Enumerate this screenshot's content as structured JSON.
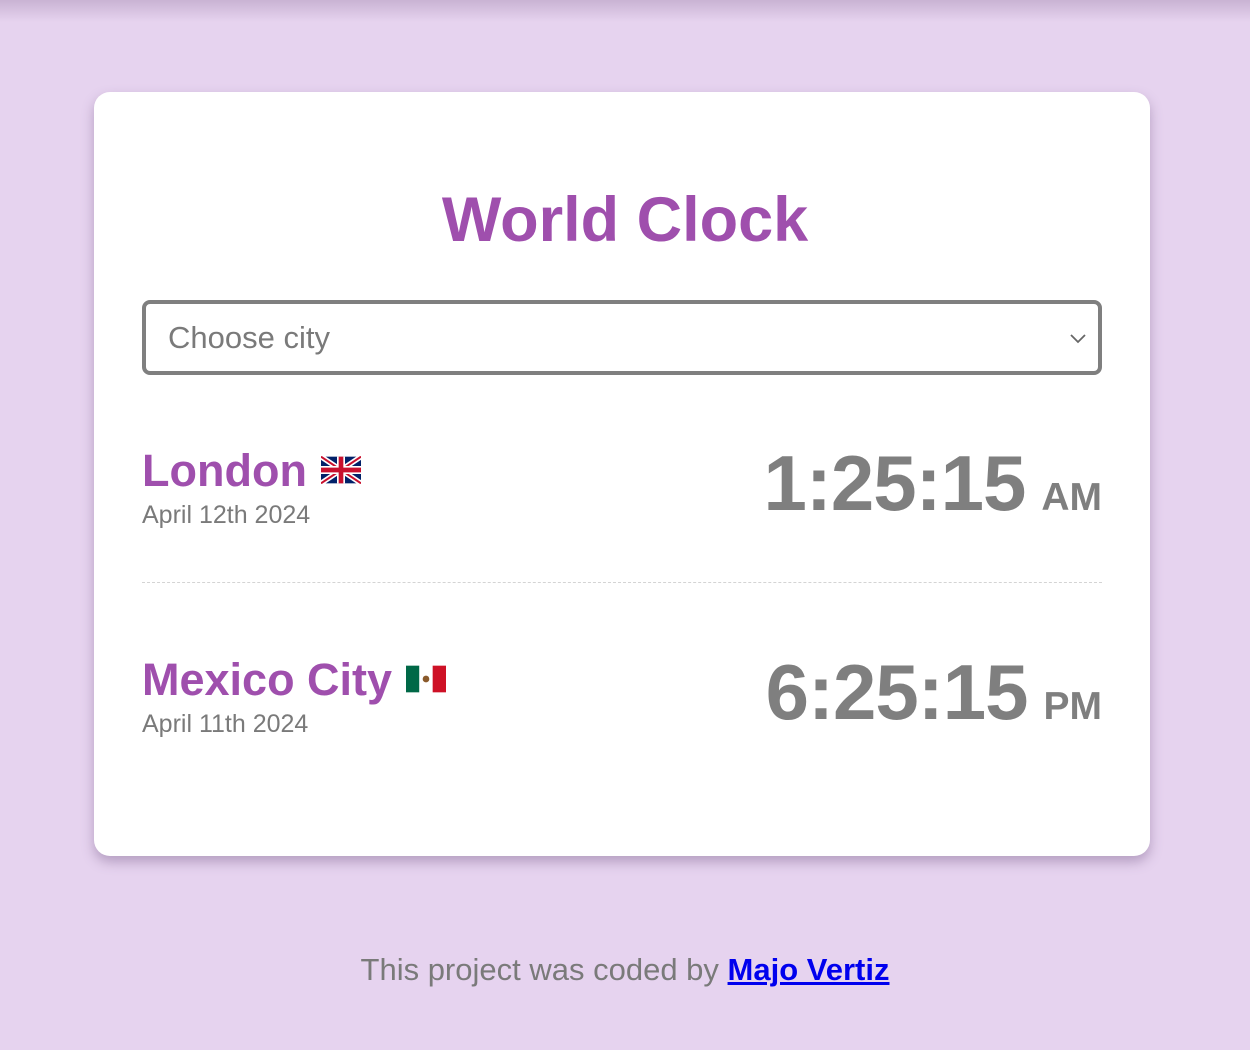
{
  "app": {
    "title": "World Clock"
  },
  "city_select": {
    "placeholder": "Choose city"
  },
  "cities": [
    {
      "name": "London",
      "flag": "uk-flag-icon",
      "date": "April 12th 2024",
      "time": "1:25:15",
      "ampm": "AM"
    },
    {
      "name": "Mexico City",
      "flag": "mexico-flag-icon",
      "date": "April 11th 2024",
      "time": "6:25:15",
      "ampm": "PM"
    }
  ],
  "footer": {
    "text": "This project was coded by",
    "link_label": "Majo Vertiz"
  },
  "colors": {
    "background": "#e6d3ef",
    "accent": "#9f4fad",
    "text_gray": "#7f7f7f",
    "link": "#0000ee"
  }
}
